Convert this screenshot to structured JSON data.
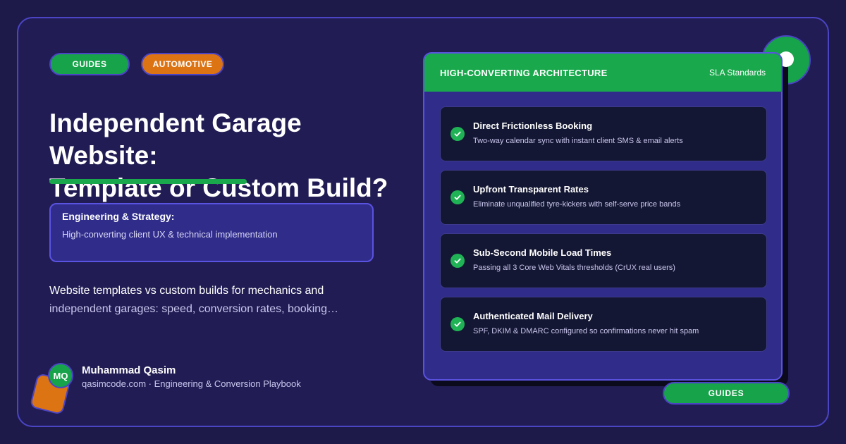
{
  "tags": {
    "guides": "GUIDES",
    "automotive": "AUTOMOTIVE"
  },
  "title": {
    "line1": "Independent Garage Website:",
    "line2": "Template or Custom Build?"
  },
  "strategy": {
    "title": "Engineering & Strategy:",
    "subtitle": "High-converting client UX & technical implementation"
  },
  "description": {
    "line1": "Website templates vs custom builds for mechanics and",
    "line2": "independent garages: speed, conversion rates, booking…"
  },
  "author": {
    "initials": "MQ",
    "name": "Muhammad Qasim",
    "meta": "qasimcode.com · Engineering & Conversion Playbook"
  },
  "panel": {
    "title": "HIGH-CONVERTING ARCHITECTURE",
    "badge": "SLA Standards",
    "features": [
      {
        "title": "Direct Frictionless Booking",
        "desc": "Two-way calendar sync with instant client SMS & email alerts"
      },
      {
        "title": "Upfront Transparent Rates",
        "desc": "Eliminate unqualified tyre-kickers with self-serve price bands"
      },
      {
        "title": "Sub-Second Mobile Load Times",
        "desc": "Passing all 3 Core Web Vitals thresholds (CrUX real users)"
      },
      {
        "title": "Authenticated Mail Delivery",
        "desc": "SPF, DKIM & DMARC configured so confirmations never hit spam"
      }
    ]
  },
  "footer_pill": "GUIDES",
  "colors": {
    "background": "#1d1a4a",
    "accent_green": "#19a94c",
    "accent_orange": "#dd7414",
    "border_purple": "#5a52e0"
  }
}
